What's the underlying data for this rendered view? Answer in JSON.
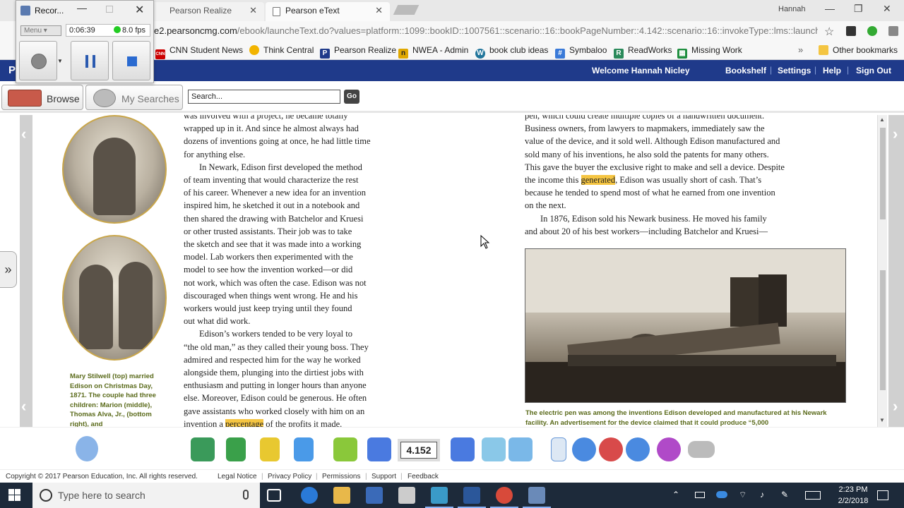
{
  "browser": {
    "tabs": [
      {
        "label": "Pearson Realize"
      },
      {
        "label": "Pearson eText"
      }
    ],
    "profile_name": "Hannah",
    "url_host": "e2.pearsoncmg.com",
    "url_path": "/ebook/launcheText.do?values=platform::1099::bookID::1007561::scenario::16::bookPageNumber::4.142::scenario::16::invokeType::lms::launch..."
  },
  "bookmarks": [
    {
      "label": "CNN Student News",
      "color": "#cc0000",
      "glyph": "CNN"
    },
    {
      "label": "Think Central",
      "color": "#f2b400",
      "glyph": ""
    },
    {
      "label": "Pearson Realize",
      "color": "#1f3a8a",
      "glyph": "P"
    },
    {
      "label": "NWEA - Admin",
      "color": "#e0a800",
      "glyph": "n"
    },
    {
      "label": "book club ideas",
      "color": "#21759b",
      "glyph": "W"
    },
    {
      "label": "Symbaloo",
      "color": "#3a7ad8",
      "glyph": "#"
    },
    {
      "label": "ReadWorks",
      "color": "#2a8a5a",
      "glyph": "R"
    },
    {
      "label": "Missing Work",
      "color": "#1e8e3e",
      "glyph": "▦"
    },
    {
      "label": "Other bookmarks",
      "color": "#f4c542",
      "glyph": ""
    }
  ],
  "recorder": {
    "title": "Recor...",
    "menu_label": "Menu",
    "elapsed": "0:06:39",
    "fps": "8.0 fps"
  },
  "pearson": {
    "logo": "P",
    "welcome": "Welcome Hannah Nicley",
    "nav": [
      "Bookshelf",
      "Settings",
      "Help",
      "Sign Out"
    ],
    "browse_label": "Browse",
    "my_searches_label": "My Searches",
    "search_value": "Search...",
    "go_label": "Go"
  },
  "page": {
    "caption_left": "Mary Stilwell (top) married Edison on Christmas Day, 1871. The couple had three children: Marion (middle), Thomas Alva, Jr., (bottom right), and",
    "col1": [
      {
        "text": "was involved with a project, he became totally",
        "indent": false
      },
      {
        "text": "wrapped up in it. And since he almost always had",
        "indent": false
      },
      {
        "text": "dozens of inventions going at once, he had little time",
        "indent": false
      },
      {
        "text": "for anything else.",
        "indent": false
      },
      {
        "text": "In Newark, Edison first developed the method",
        "indent": true
      },
      {
        "text": "of team inventing that would characterize the rest",
        "indent": false
      },
      {
        "text": "of his career. Whenever a new idea for an invention",
        "indent": false
      },
      {
        "text": "inspired him, he sketched it out in a notebook and",
        "indent": false
      },
      {
        "text": "then shared the drawing with Batchelor and Kruesi",
        "indent": false
      },
      {
        "text": "or other trusted assistants. Their job was to take",
        "indent": false
      },
      {
        "text": "the sketch and see that it was made into a working",
        "indent": false
      },
      {
        "text": "model. Lab workers then experimented with the",
        "indent": false
      },
      {
        "text": "model to see how the invention worked—or did",
        "indent": false
      },
      {
        "text": "not work, which was often the case. Edison was not",
        "indent": false
      },
      {
        "text": "discouraged when things went wrong. He and his",
        "indent": false
      },
      {
        "text": "workers would just keep trying until they found",
        "indent": false
      },
      {
        "text": "out what did work.",
        "indent": false
      },
      {
        "text": "Edison’s workers tended to be very loyal to",
        "indent": true
      },
      {
        "text": "“the old man,” as they called their young boss. They",
        "indent": false
      },
      {
        "text": "admired and respected him for the way he worked",
        "indent": false
      },
      {
        "text": "alongside them, plunging into the dirtiest jobs with",
        "indent": false
      },
      {
        "text": "enthusiasm and putting in longer hours than anyone",
        "indent": false
      },
      {
        "text": "else. Moreover, Edison could be generous. He often",
        "indent": false
      },
      {
        "text": "gave assistants who worked closely with him on an",
        "indent": false
      }
    ],
    "col1_last_pre": "invention a ",
    "col1_last_hl": "percentage",
    "col1_last_post": " of the profits it made.",
    "col2": [
      {
        "text": "pen, which could create multiple copies of a handwritten document.",
        "indent": false
      },
      {
        "text": "Business owners, from lawyers to mapmakers, immediately saw the",
        "indent": false
      },
      {
        "text": "value of the device, and it sold well. Although Edison manufactured and",
        "indent": false
      },
      {
        "text": "sold many of his inventions, he also sold the patents for many others.",
        "indent": false
      },
      {
        "text": "This gave the buyer the exclusive right to make and sell a device. Despite",
        "indent": false
      }
    ],
    "col2_hl_pre": "the income this ",
    "col2_hl": "generated",
    "col2_hl_post": ", Edison was usually short of cash. That’s",
    "col2_rest": [
      {
        "text": "because he tended to spend most of what he earned from one invention",
        "indent": false
      },
      {
        "text": "on the next.",
        "indent": false
      },
      {
        "text": "In 1876, Edison sold his Newark business. He moved his family",
        "indent": true
      },
      {
        "text": "and about 20 of his best workers—including Batchelor and Kruesi—",
        "indent": false
      }
    ],
    "caption_right": "The electric pen was among the inventions Edison developed and manufactured at his Newark facility. An advertisement for the device claimed that it could produce “5,000"
  },
  "toolbar": {
    "page_number": "4.152"
  },
  "footer": {
    "copyright": "Copyright © 2017 Pearson Education, Inc. All rights reserved.",
    "links": [
      "Legal Notice",
      "Privacy Policy",
      "Permissions",
      "Support",
      "Feedback"
    ]
  },
  "taskbar": {
    "search_placeholder": "Type here to search",
    "time": "2:23 PM",
    "date": "2/2/2018"
  }
}
